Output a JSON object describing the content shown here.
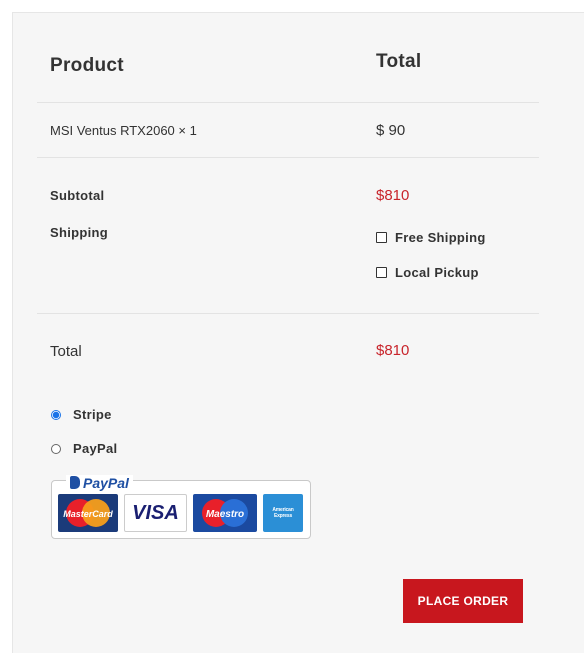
{
  "table": {
    "header_product": "Product",
    "header_total": "Total",
    "item_name": "MSI Ventus RTX2060 × 1",
    "item_price": "$ 90",
    "subtotal_label": "Subtotal",
    "subtotal_value": "$810",
    "shipping_label": "Shipping",
    "shipping_options": [
      "Free Shipping",
      "Local Pickup"
    ],
    "total_label": "Total",
    "total_value": "$810"
  },
  "payment": {
    "methods": [
      "Stripe",
      "PayPal"
    ],
    "selected": "Stripe",
    "paypal_logo_text": "PayPal",
    "card_logos": [
      "MasterCard",
      "VISA",
      "Maestro",
      "American Express"
    ]
  },
  "actions": {
    "place_order_label": "PLACE ORDER"
  },
  "colors": {
    "accent_red": "#c8171e",
    "price_red": "#c8242b",
    "radio_blue": "#1a73e8"
  }
}
